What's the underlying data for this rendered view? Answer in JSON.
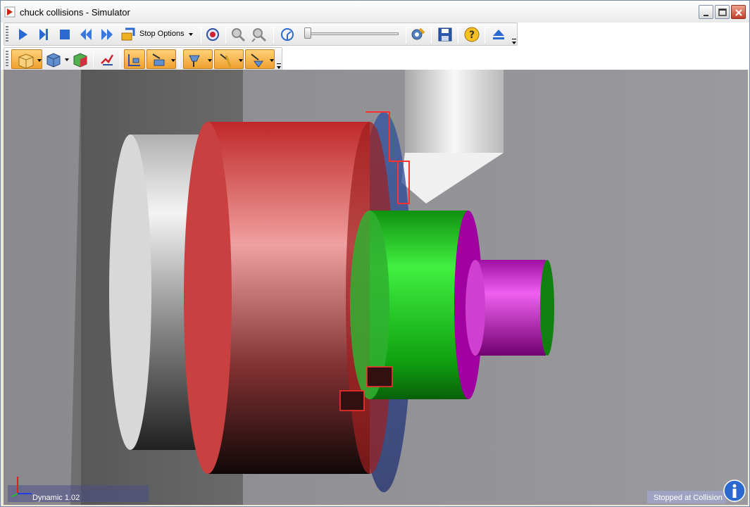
{
  "window": {
    "title": "chuck collisions - Simulator"
  },
  "toolbar": {
    "stop_options_label": "Stop Options"
  },
  "status": {
    "mode": "Dynamic 1.02",
    "state": "Stopped at Collision"
  },
  "colors": {
    "accent_orange": "#f0a030",
    "chuck_red": "#d03030",
    "part_green": "#20c020",
    "part_magenta": "#c020c0",
    "jaw_blue": "#3050a0"
  }
}
